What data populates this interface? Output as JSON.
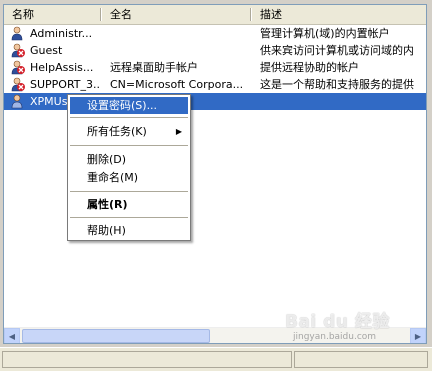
{
  "columns": {
    "name": "名称",
    "full_name": "全名",
    "description": "描述"
  },
  "users": [
    {
      "name": "Administr...",
      "full_name": "",
      "description": "管理计算机(域)的内置帐户",
      "disabled": false
    },
    {
      "name": "Guest",
      "full_name": "",
      "description": "供来宾访问计算机或访问域的内",
      "disabled": true
    },
    {
      "name": "HelpAssis...",
      "full_name": "远程桌面助手帐户",
      "description": "提供远程协助的帐户",
      "disabled": true
    },
    {
      "name": "SUPPORT_3...",
      "full_name": "CN=Microsoft Corpora...",
      "description": "这是一个帮助和支持服务的提供",
      "disabled": true
    },
    {
      "name": "XPMUser",
      "full_name": "",
      "description": "",
      "disabled": false,
      "selected": true
    }
  ],
  "context_menu": {
    "set_password": "设置密码(S)...",
    "all_tasks": "所有任务(K)",
    "delete": "删除(D)",
    "rename": "重命名(M)",
    "properties": "属性(R)",
    "help": "帮助(H)"
  },
  "watermark": {
    "logo": "Bai du 经验",
    "url": "jingyan.baidu.com"
  },
  "colors": {
    "selection": "#316ac5",
    "header": "#ece9d8",
    "disabled_badge": "#d4202a"
  }
}
